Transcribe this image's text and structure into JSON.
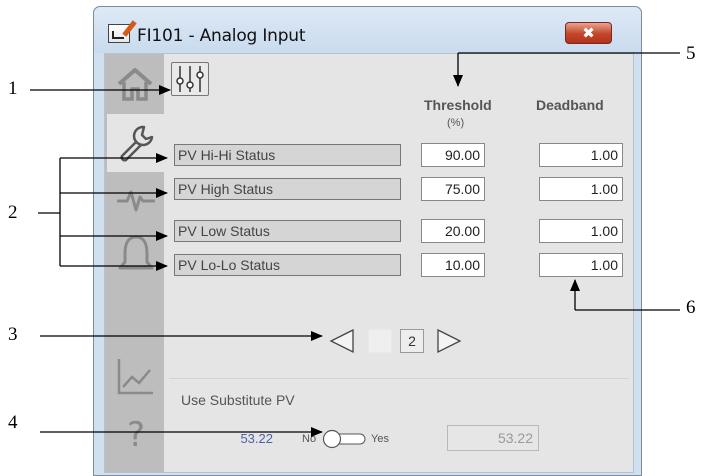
{
  "window": {
    "title": "FI101 - Analog Input",
    "close_label": "✖"
  },
  "sidebar": {
    "tabs": [
      {
        "icon": "home-icon"
      },
      {
        "icon": "wrench-icon",
        "selected": true
      },
      {
        "icon": "pulse-icon"
      },
      {
        "icon": "bell-icon"
      },
      {
        "icon": "trend-icon"
      },
      {
        "icon": "help-icon",
        "label": "?"
      }
    ]
  },
  "main": {
    "header_icon": "sliders-icon",
    "columns": {
      "threshold": "Threshold",
      "threshold_unit": "(%)",
      "deadband": "Deadband"
    },
    "rows": [
      {
        "label": "PV Hi-Hi Status",
        "threshold": "90.00",
        "deadband": "1.00"
      },
      {
        "label": "PV High Status",
        "threshold": "75.00",
        "deadband": "1.00"
      },
      {
        "label": "PV Low Status",
        "threshold": "20.00",
        "deadband": "1.00"
      },
      {
        "label": "PV Lo-Lo Status",
        "threshold": "10.00",
        "deadband": "1.00"
      }
    ],
    "pager": {
      "page": "2"
    },
    "substitute": {
      "label": "Use Substitute PV",
      "pv_value": "53.22",
      "no_label": "No",
      "yes_label": "Yes",
      "field_value": "53.22",
      "enabled": false
    }
  },
  "callouts": [
    "1",
    "2",
    "3",
    "4",
    "5",
    "6"
  ],
  "colors": {
    "titlebar": "#cfe0f1",
    "sidebar": "#bdbdbd",
    "panel": "#e5e5e5",
    "close_button": "#c3452b",
    "pv_value": "#4e60a6"
  }
}
